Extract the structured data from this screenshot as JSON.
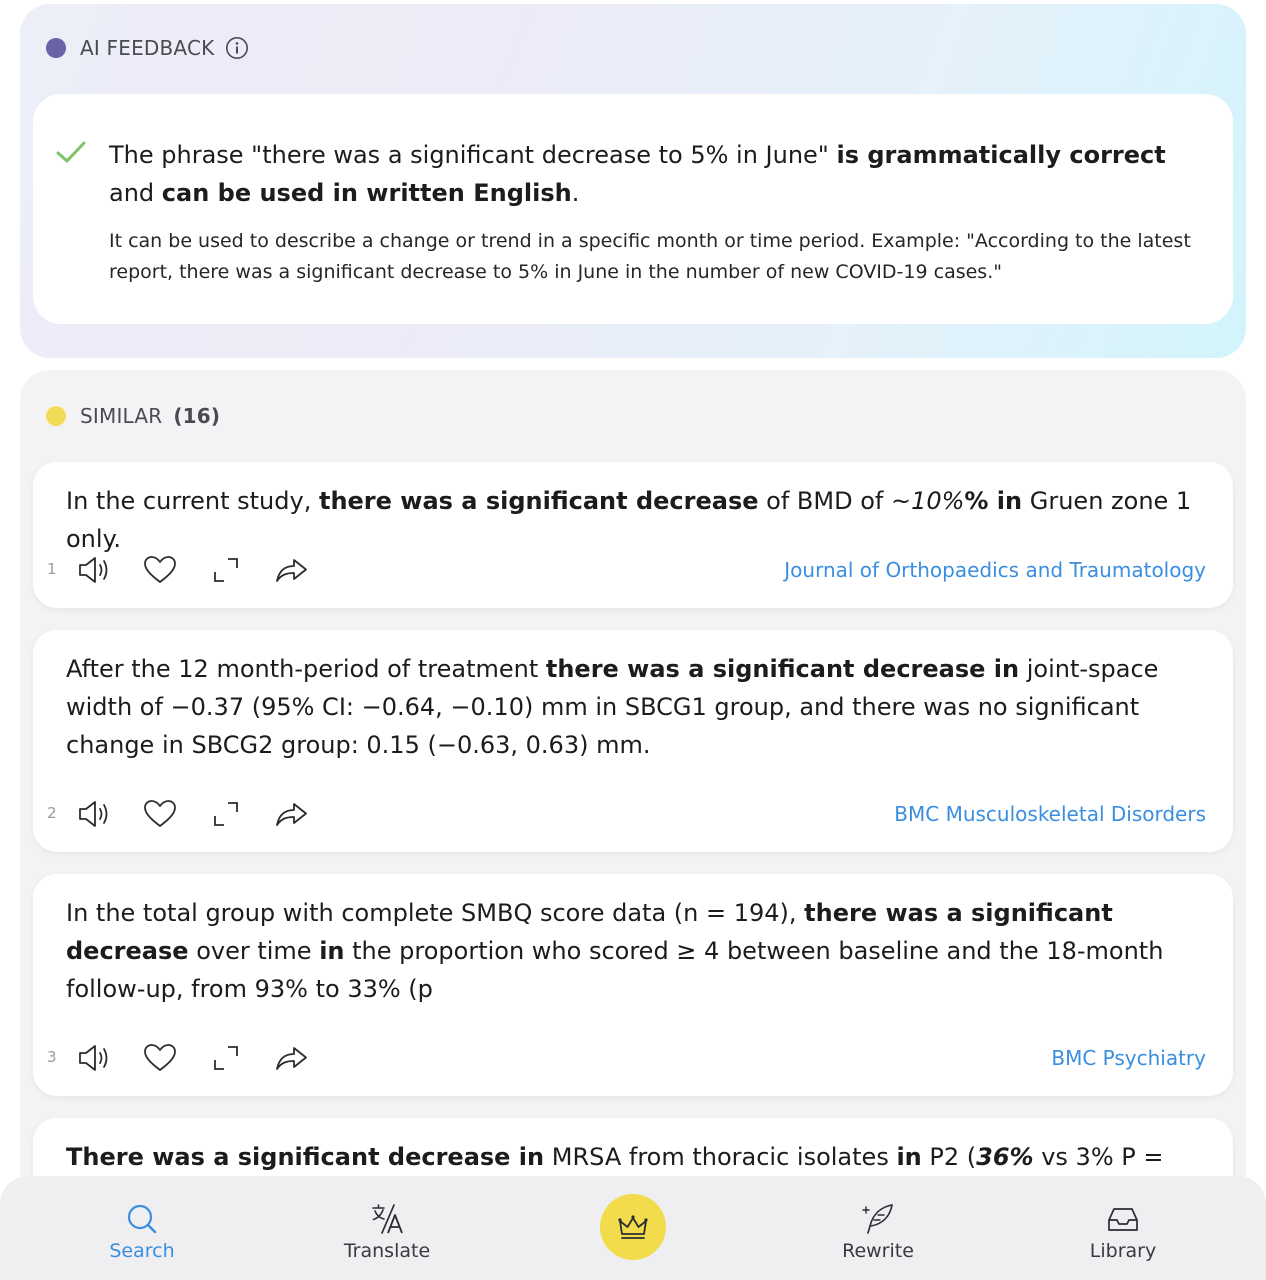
{
  "ai_feedback": {
    "header": "AI FEEDBACK",
    "main_plain_1": "The phrase \"there was a significant decrease to 5% in June\" ",
    "main_bold_1": "is grammatically correct",
    "main_plain_2": " and ",
    "main_bold_2": "can be used in written English",
    "main_plain_3": ".",
    "detail": "It can be used to describe a change or trend in a specific month or time period. Example: \"According to the latest report, there was a significant decrease to 5% in June in the number of new COVID-19 cases.\""
  },
  "similar": {
    "header": "SIMILAR",
    "count": "(16)",
    "examples": [
      {
        "number": "1",
        "source": "Journal of Orthopaedics and Traumatology",
        "t1": "In the current study, ",
        "t2": "there was a significant decrease",
        "t3": " of BMD of ",
        "t4": "~10%",
        "t5": "% in",
        "t6": " Gruen zone 1 only."
      },
      {
        "number": "2",
        "source": "BMC Musculoskeletal Disorders",
        "t1": "After the 12 month-period of treatment ",
        "t2": "there was a significant decrease in",
        "t3": " joint-space width of −0.37 (95% CI: −0.64, −0.10) mm in SBCG1 group, and there was no significant change in SBCG2 group: 0.15 (−0.63, 0.63) mm."
      },
      {
        "number": "3",
        "source": "BMC Psychiatry",
        "t1": "In the total group with complete SMBQ score data (n = 194), ",
        "t2": "there was a significant decrease",
        "t3": " over time ",
        "t4": "in",
        "t5": " the proportion who scored ≥ 4 between baseline and the 18-month follow-up, from 93% to 33% (p"
      },
      {
        "t1": "There was a significant decrease in",
        "t2": " MRSA from thoracic isolates ",
        "t3": "in",
        "t4": " P2 (",
        "t5": "36%",
        "t6": " vs 3% P ="
      }
    ]
  },
  "nav": {
    "search": "Search",
    "translate": "Translate",
    "rewrite": "Rewrite",
    "library": "Library",
    "active": "search"
  },
  "colors": {
    "accent_blue": "#3a8ee0",
    "highlight_yellow": "#f6e57f",
    "crown_yellow": "#f2dc4c",
    "ai_dot_purple": "#6a63a8",
    "similar_dot_yellow": "#f2dc5a",
    "check_green": "#7cc36b"
  }
}
